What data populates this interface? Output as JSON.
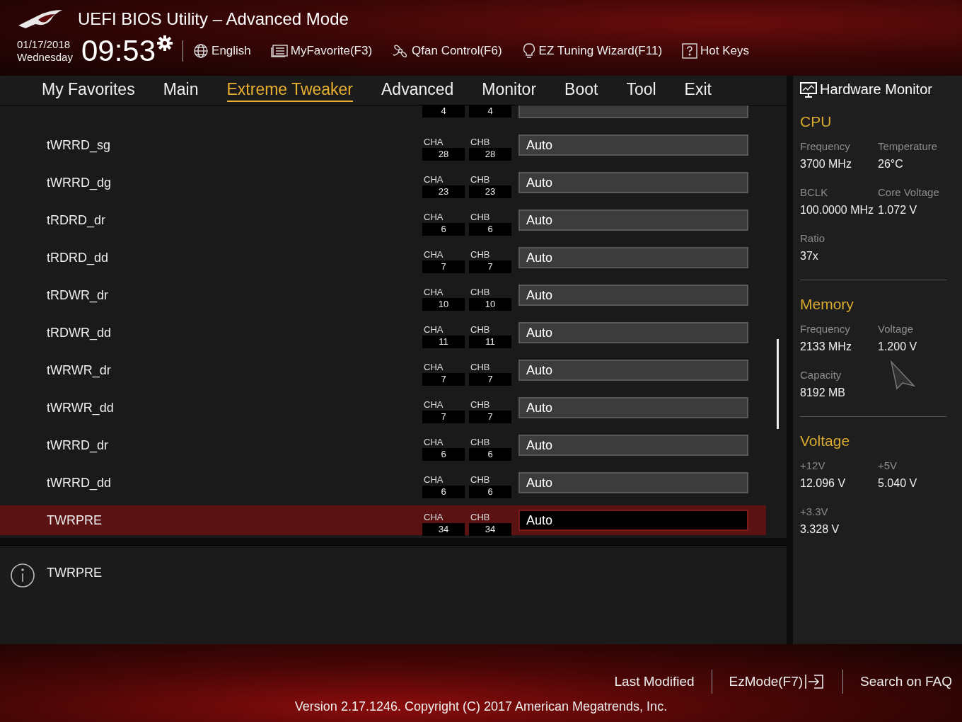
{
  "header": {
    "title": "UEFI BIOS Utility – Advanced Mode",
    "date": "01/17/2018",
    "day": "Wednesday",
    "time": "09:53",
    "tools": [
      {
        "label": "English"
      },
      {
        "label": "MyFavorite(F3)"
      },
      {
        "label": "Qfan Control(F6)"
      },
      {
        "label": "EZ Tuning Wizard(F11)"
      },
      {
        "label": "Hot Keys"
      }
    ]
  },
  "tabs": [
    {
      "label": "My Favorites",
      "selected": false
    },
    {
      "label": "Main",
      "selected": false
    },
    {
      "label": "Extreme Tweaker",
      "selected": true
    },
    {
      "label": "Advanced",
      "selected": false
    },
    {
      "label": "Monitor",
      "selected": false
    },
    {
      "label": "Boot",
      "selected": false
    },
    {
      "label": "Tool",
      "selected": false
    },
    {
      "label": "Exit",
      "selected": false
    }
  ],
  "rows": [
    {
      "cha": "4",
      "chb": "4",
      "selected": false
    },
    {
      "name": "tWRRD_sg",
      "cha_label": "CHA",
      "cha": "28",
      "chb_label": "CHB",
      "chb": "28",
      "value": "Auto",
      "selected": false
    },
    {
      "name": "tWRRD_dg",
      "cha_label": "CHA",
      "cha": "23",
      "chb_label": "CHB",
      "chb": "23",
      "value": "Auto",
      "selected": false
    },
    {
      "name": "tRDRD_dr",
      "cha_label": "CHA",
      "cha": "6",
      "chb_label": "CHB",
      "chb": "6",
      "value": "Auto",
      "selected": false
    },
    {
      "name": "tRDRD_dd",
      "cha_label": "CHA",
      "cha": "7",
      "chb_label": "CHB",
      "chb": "7",
      "value": "Auto",
      "selected": false
    },
    {
      "name": "tRDWR_dr",
      "cha_label": "CHA",
      "cha": "10",
      "chb_label": "CHB",
      "chb": "10",
      "value": "Auto",
      "selected": false
    },
    {
      "name": "tRDWR_dd",
      "cha_label": "CHA",
      "cha": "11",
      "chb_label": "CHB",
      "chb": "11",
      "value": "Auto",
      "selected": false
    },
    {
      "name": "tWRWR_dr",
      "cha_label": "CHA",
      "cha": "7",
      "chb_label": "CHB",
      "chb": "7",
      "value": "Auto",
      "selected": false
    },
    {
      "name": "tWRWR_dd",
      "cha_label": "CHA",
      "cha": "7",
      "chb_label": "CHB",
      "chb": "7",
      "value": "Auto",
      "selected": false
    },
    {
      "name": "tWRRD_dr",
      "cha_label": "CHA",
      "cha": "6",
      "chb_label": "CHB",
      "chb": "6",
      "value": "Auto",
      "selected": false
    },
    {
      "name": "tWRRD_dd",
      "cha_label": "CHA",
      "cha": "6",
      "chb_label": "CHB",
      "chb": "6",
      "value": "Auto",
      "selected": false
    },
    {
      "name": "TWRPRE",
      "cha_label": "CHA",
      "cha": "34",
      "chb_label": "CHB",
      "chb": "34",
      "value": "Auto",
      "selected": true
    }
  ],
  "info": {
    "text": "TWRPRE"
  },
  "monitor": {
    "title": "Hardware Monitor",
    "sections": [
      {
        "title": "CPU",
        "fields": [
          {
            "label": "Frequency",
            "value": "3700 MHz"
          },
          {
            "label": "Temperature",
            "value": "26°C"
          },
          {
            "label": "BCLK",
            "value": "100.0000 MHz"
          },
          {
            "label": "Core Voltage",
            "value": "1.072 V"
          },
          {
            "label": "Ratio",
            "value": "37x"
          }
        ]
      },
      {
        "title": "Memory",
        "fields": [
          {
            "label": "Frequency",
            "value": "2133 MHz"
          },
          {
            "label": "Voltage",
            "value": "1.200 V"
          },
          {
            "label": "Capacity",
            "value": "8192 MB"
          }
        ]
      },
      {
        "title": "Voltage",
        "fields": [
          {
            "label": "+12V",
            "value": "12.096 V"
          },
          {
            "label": "+5V",
            "value": "5.040 V"
          },
          {
            "label": "+3.3V",
            "value": "3.328 V"
          }
        ]
      }
    ]
  },
  "footer": {
    "links": [
      "Last Modified",
      "EzMode(F7)",
      "Search on FAQ"
    ],
    "version": "Version 2.17.1246. Copyright (C) 2017 American Megatrends, Inc."
  }
}
